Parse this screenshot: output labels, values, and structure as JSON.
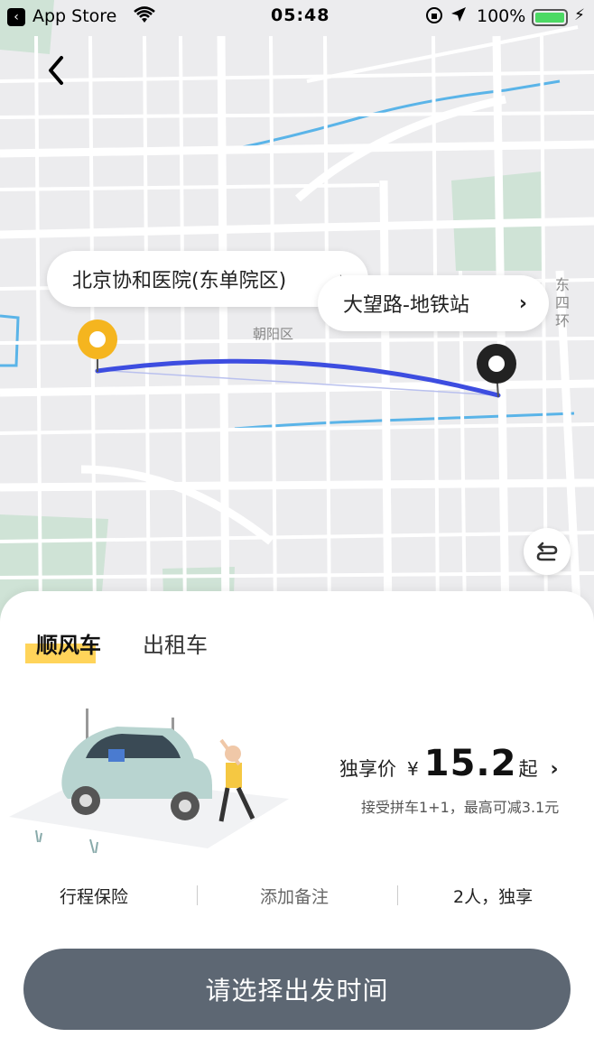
{
  "status_bar": {
    "back_app": "App Store",
    "time": "05:48",
    "battery": "100%",
    "icons": [
      "wifi-icon",
      "orientation-lock-icon",
      "location-arrow-icon",
      "battery-icon",
      "charging-bolt-icon"
    ]
  },
  "map": {
    "origin_label": "北京协和医院(东单院区)",
    "destination_label": "大望路-地铁站",
    "district_label": "朝阳区",
    "road_label": "东四环",
    "route_color": "#3d4de0",
    "origin_pin_color": "#f5b51f",
    "destination_pin_color": "#222222"
  },
  "tabs": [
    {
      "label": "顺风车",
      "active": true
    },
    {
      "label": "出租车",
      "active": false
    }
  ],
  "price": {
    "label": "独享价",
    "currency": "¥",
    "value": "15.2",
    "suffix": "起",
    "note": "接受拼车1+1，最高可减3.1元"
  },
  "options": {
    "insurance": "行程保险",
    "remark": "添加备注",
    "passengers": "2人，独享"
  },
  "cta": {
    "label": "请选择出发时间",
    "color": "#5d6773"
  },
  "accent": "#ffd45a"
}
